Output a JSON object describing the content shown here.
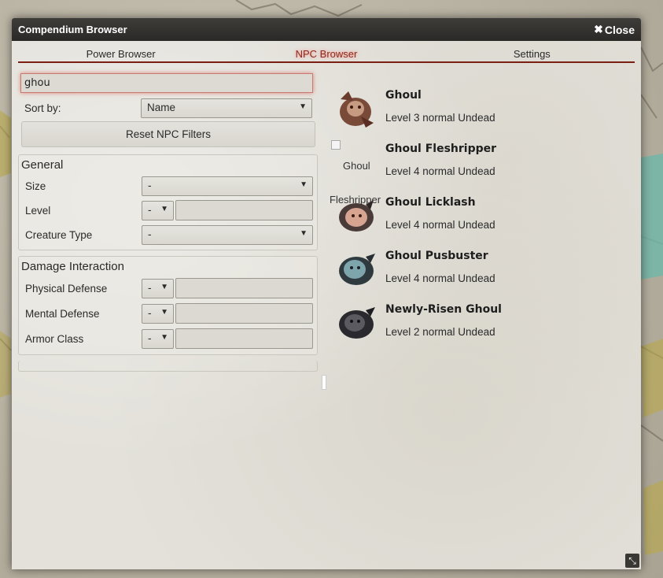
{
  "window": {
    "title": "Compendium Browser",
    "close_label": "Close"
  },
  "tabs": [
    {
      "label": "Power Browser",
      "active": false
    },
    {
      "label": "NPC Browser",
      "active": true
    },
    {
      "label": "Settings",
      "active": false
    }
  ],
  "search": {
    "value": "ghou"
  },
  "sort": {
    "label": "Sort by:",
    "value": "Name"
  },
  "reset_button": "Reset NPC Filters",
  "general": {
    "title": "General",
    "size_label": "Size",
    "size_value": "-",
    "level_label": "Level",
    "level_op": "-",
    "level_value": "",
    "type_label": "Creature Type",
    "type_value": "-"
  },
  "damage": {
    "title": "Damage Interaction",
    "physical_label": "Physical Defense",
    "physical_op": "-",
    "mental_label": "Mental Defense",
    "mental_op": "-",
    "armor_label": "Armor Class",
    "armor_op": "-"
  },
  "npcs": [
    {
      "name": "Ghoul",
      "desc": "Level 3 normal Undead",
      "token_color": "#7a4a38"
    },
    {
      "name": "Ghoul Fleshripper",
      "desc": "Level 4 normal Undead",
      "broken_image": true,
      "alt": "Ghoul"
    },
    {
      "name": "Ghoul Licklash",
      "desc": "Level 4 normal Undead",
      "token_color": "#b87a68",
      "overlap_text": "Fleshripper"
    },
    {
      "name": "Ghoul Pusbuster",
      "desc": "Level 4 normal Undead",
      "token_color": "#5f7f86"
    },
    {
      "name": "Newly-Risen Ghoul",
      "desc": "Level 2 normal Undead",
      "token_color": "#3a3a3e"
    }
  ],
  "colors": {
    "accent": "#7a1f12",
    "titlebar": "#2f2e2b",
    "panel": "#e3e1da"
  },
  "icons": {
    "close": "close-icon",
    "resize": "resize-icon",
    "dropdown": "caret-down-icon"
  }
}
